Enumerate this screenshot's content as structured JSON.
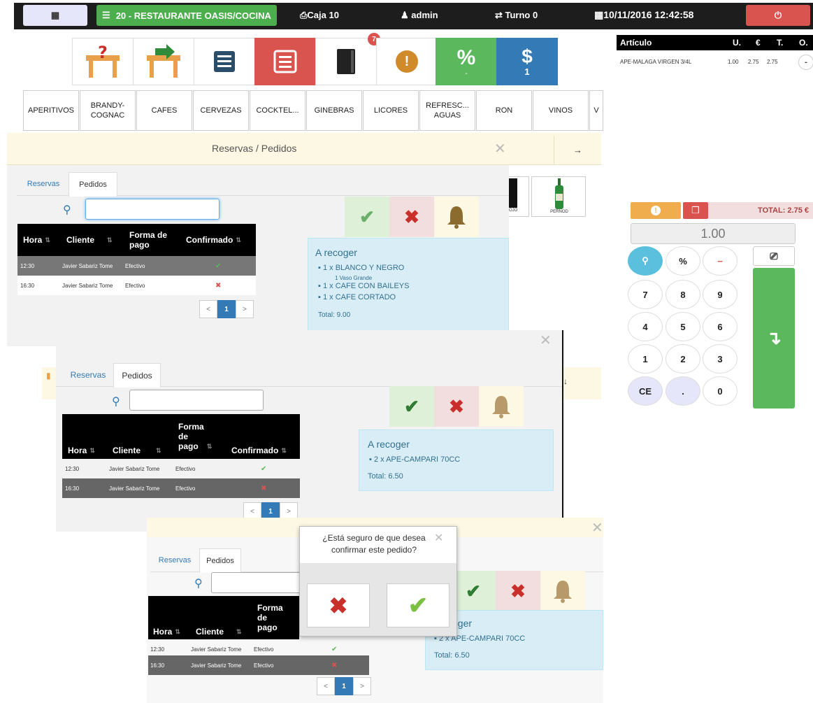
{
  "topbar": {
    "table_label": "20 - RESTAURANTE OASIS/COCINA",
    "caja": "Caja 10",
    "user": "admin",
    "turno": "Turno 0",
    "datetime": "10/11/2016 12:42:58",
    "power_icon": "power-icon",
    "grid_icon": "grid-icon"
  },
  "toolbar": {
    "notification_count": "7",
    "discount_symbol": "%",
    "discount_sub": "-",
    "pay_symbol": "$",
    "pay_count": "1"
  },
  "categories": [
    "APERITIVOS",
    "BRANDY-\nCOGNAC",
    "CAFES",
    "CERVEZAS",
    "COCKTEL...",
    "GINEBRAS",
    "LICORES",
    "REFRESC...\nAGUAS",
    "RON",
    "VINOS",
    "V"
  ],
  "ticket": {
    "headers": [
      "Artículo",
      "U.",
      "€",
      "T.",
      "O."
    ],
    "row": {
      "name": "APE-MALAGA VIRGEN 3/4L",
      "units": "1.00",
      "price": "2.75",
      "total": "2.75",
      "op": "-"
    }
  },
  "keypad": {
    "total": "TOTAL: 2.75 €",
    "display": "1.00",
    "keys": [
      "%",
      "−",
      "7",
      "8",
      "9",
      "4",
      "5",
      "6",
      "1",
      "2",
      "3",
      "CE",
      ".",
      "0"
    ],
    "enter_symbol": "↴"
  },
  "products": {
    "left_label": "OJO",
    "right_label": "PERNOD"
  },
  "modal": {
    "title": "Reservas / Pedidos",
    "arrow": "→",
    "down_arrow": "↓",
    "close": "✕",
    "tabs": [
      "Reservas",
      "Pedidos"
    ],
    "columns": [
      "Hora",
      "Cliente",
      "Forma de pago",
      "Confirmado"
    ],
    "columns_wrapped": [
      "Hora",
      "Cliente",
      "Forma\nde\npago",
      "Confirmado"
    ],
    "rows": [
      {
        "hora": "12:30",
        "cliente": "Javier Sabariz Tome",
        "pago": "Efectivo",
        "confirmado": "✔"
      },
      {
        "hora": "16:30",
        "cliente": "Javier Sabariz Tome",
        "pago": "Efectivo",
        "confirmado": "✖"
      }
    ],
    "page_prev": "<",
    "page_cur": "1",
    "page_next": ">",
    "accept": "✔",
    "reject": "✖",
    "bell": "bell-icon"
  },
  "order1": {
    "title": "A recoger",
    "items": [
      "1 x BLANCO Y NEGRO",
      "1 Vaso Grande",
      "1 x CAFE CON BAILEYS",
      "1 x CAFE CORTADO"
    ],
    "total": "Total: 9.00"
  },
  "order2": {
    "title": "A recoger",
    "items": [
      "2 x APE-CAMPARI 70CC"
    ],
    "total": "Total: 6.50"
  },
  "order3": {
    "title_partial": "oger",
    "items": [
      "2 x APE-CAMPARI 70CC"
    ],
    "total": "Total: 6.50"
  },
  "confirm": {
    "question": "¿Está seguro de que desea\nconfirmar este pedido?",
    "no": "✖",
    "yes": "✔"
  },
  "colors": {
    "green": "#5cb85c",
    "red": "#d9534f",
    "blue": "#337ab7",
    "orange": "#f0ad4e",
    "lavender": "#e6e6fa"
  }
}
